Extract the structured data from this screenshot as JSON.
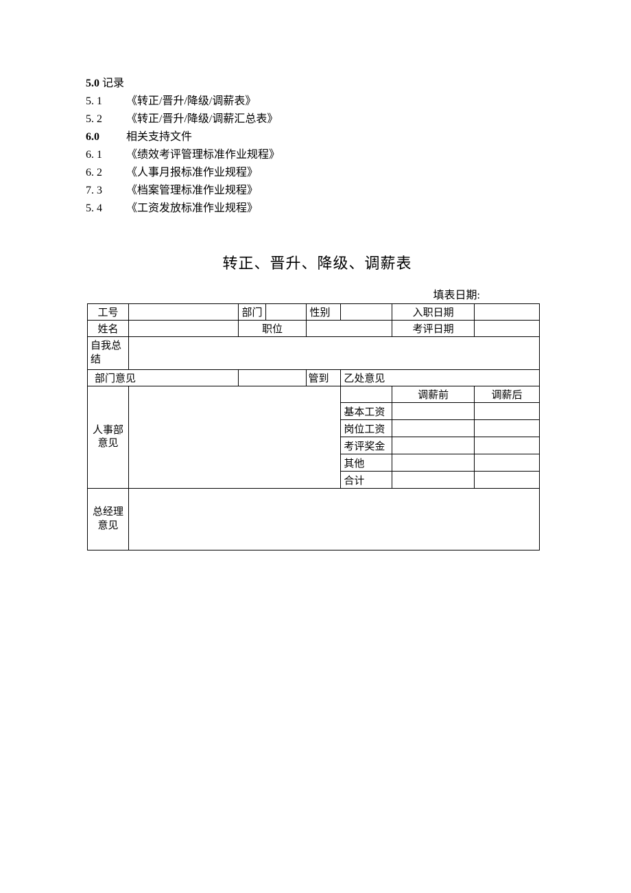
{
  "section5": {
    "heading_num": "5.0",
    "heading_text": "记录",
    "items": [
      {
        "num": "5.  1",
        "text": "《转正/晋升/降级/调薪表》"
      },
      {
        "num": "5.  2",
        "text": "《转正/晋升/降级/调薪汇总表》"
      }
    ]
  },
  "section6": {
    "heading_num": "6.0",
    "heading_text": "相关支持文件",
    "items": [
      {
        "num": "6. 1",
        "text": "《绩效考评管理标准作业规程》"
      },
      {
        "num": "6.  2",
        "text": "《人事月报标准作业规程》"
      },
      {
        "num": "7.  3",
        "text": "《档案管理标准作业规程》"
      },
      {
        "num": "5. 4",
        "text": "《工资发放标准作业规程》"
      }
    ]
  },
  "form": {
    "title": "转正、晋升、降级、调薪表",
    "fill_date_label": "填表日期:",
    "row1": {
      "emp_no": "工号",
      "dept": "部门",
      "gender": "性别",
      "hire_date": "入职日期"
    },
    "row2": {
      "name": "姓名",
      "position": "职位",
      "review_date": "考评日期"
    },
    "self_summary": "自我总结",
    "dept_opinion": "部门意见",
    "mgmt_opinion1": "管到",
    "mgmt_opinion2": "乙处意见",
    "hr_opinion": "人事部意见",
    "salary": {
      "before": "调薪前",
      "after": "调薪后",
      "base": "基本工资",
      "position_salary": "岗位工资",
      "bonus": "考评奖金",
      "other": "其他",
      "total": "合计"
    },
    "gm_opinion": "总经理意见"
  }
}
